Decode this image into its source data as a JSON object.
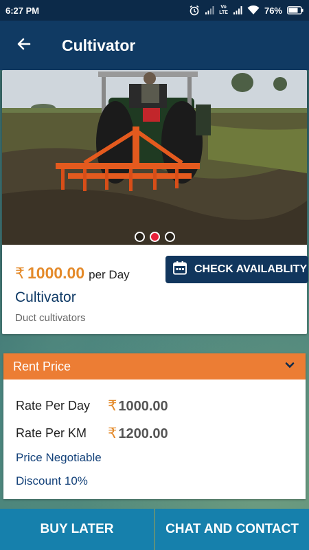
{
  "status_bar": {
    "time": "6:27 PM",
    "battery": "76%",
    "network": "Vo LTE",
    "icons": [
      "alarm-icon",
      "signal-icon",
      "volte-icon",
      "signal-icon",
      "wifi-icon",
      "battery-icon"
    ]
  },
  "app_bar": {
    "title": "Cultivator",
    "back_icon": "arrow-left-icon"
  },
  "product": {
    "carousel": {
      "count": 3,
      "active_index": 1
    },
    "currency": "₹",
    "price": "1000.00",
    "price_unit": "per Day",
    "check_button_label": "CHECK AVAILABLITY",
    "check_button_icon": "calendar-icon",
    "name": "Cultivator",
    "subtitle": "Duct cultivators"
  },
  "rent_price": {
    "title": "Rent Price",
    "expand_icon": "chevron-down-icon",
    "rows": [
      {
        "label": "Rate Per Day",
        "currency": "₹",
        "value": "1000.00"
      },
      {
        "label": "Rate Per KM",
        "currency": "₹",
        "value": "1200.00"
      }
    ],
    "negotiable": "Price Negotiable",
    "discount": "Discount 10%"
  },
  "bottom_bar": {
    "buy_later": "BUY LATER",
    "chat_contact": "CHAT AND CONTACT"
  },
  "colors": {
    "status_bar": "#0c2a49",
    "app_bar": "#103a63",
    "accent_orange": "#ec7d34",
    "price_orange": "#e48a2a",
    "button_blue": "#1680ac",
    "dark_button": "#11365d",
    "active_dot": "#e8203a"
  }
}
